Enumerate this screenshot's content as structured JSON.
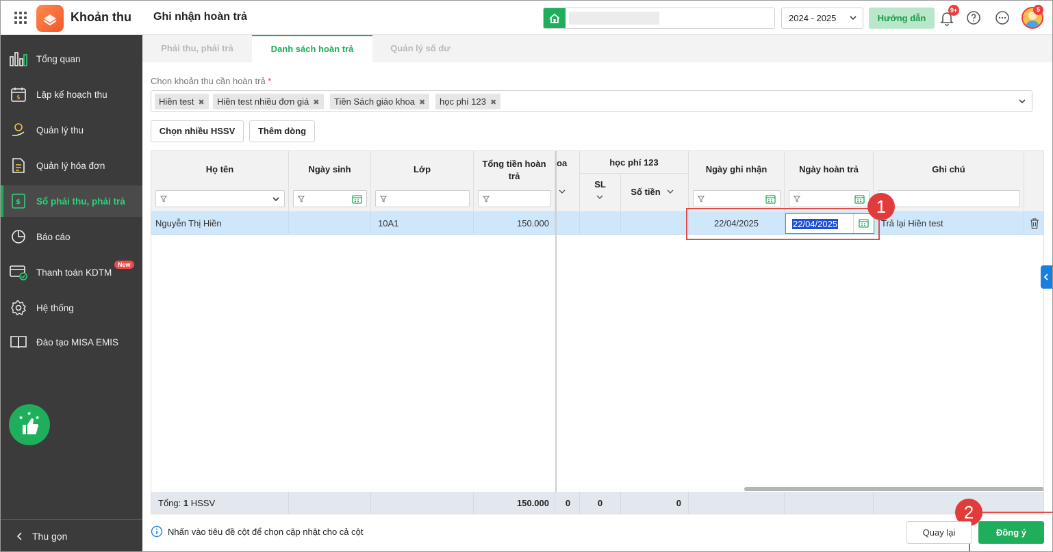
{
  "header": {
    "app_title": "Khoản thu",
    "page_title": "Ghi nhận hoàn trả",
    "school_year": "2024 - 2025",
    "guide_label": "Hướng dẫn",
    "notification_count": "9+",
    "avatar_badge": "5"
  },
  "sidebar": {
    "items": [
      {
        "label": "Tổng quan",
        "icon": "bar-chart-icon"
      },
      {
        "label": "Lập kế hoạch thu",
        "icon": "calendar-money-icon"
      },
      {
        "label": "Quản lý thu",
        "icon": "money-hand-icon"
      },
      {
        "label": "Quản lý hóa đơn",
        "icon": "invoice-icon"
      },
      {
        "label": "Sổ phải thu, phải trả",
        "icon": "ledger-icon",
        "active": true
      },
      {
        "label": "Báo cáo",
        "icon": "pie-chart-icon"
      },
      {
        "label": "Thanh toán KDTM",
        "icon": "card-payment-icon",
        "badge": "New"
      },
      {
        "label": "Hệ thống",
        "icon": "gear-icon"
      },
      {
        "label": "Đào tạo MISA EMIS",
        "icon": "book-icon"
      }
    ],
    "collapse_label": "Thu gọn"
  },
  "tabs": [
    {
      "label": "Phải thu, phải trả",
      "active": false
    },
    {
      "label": "Danh sách hoàn trả",
      "active": true
    },
    {
      "label": "Quản lý số dư",
      "active": false
    }
  ],
  "form": {
    "choose_label": "Chọn khoản thu cần hoàn trả",
    "required_mark": "*",
    "tags": [
      "Hiền test",
      "Hiền test nhiều đơn giá",
      "Tiền Sách giáo khoa",
      "học phí 123"
    ],
    "btn_choose_many": "Chọn nhiều HSSV",
    "btn_add_row": "Thêm dòng"
  },
  "grid": {
    "headers": {
      "name": "Họ tên",
      "dob": "Ngày sinh",
      "class": "Lớp",
      "total": "Tổng tiền hoàn trả",
      "partial": "oa",
      "group": "học phí 123",
      "qty": "SL",
      "amount": "Số tiền",
      "record_date": "Ngày ghi nhận",
      "refund_date": "Ngày hoàn trả",
      "note": "Ghi chú"
    },
    "rows": [
      {
        "name": "Nguyễn Thị Hiền",
        "dob": "",
        "class": "10A1",
        "total": "150.000",
        "record_date": "22/04/2025",
        "refund_date": "22/04/2025",
        "note": "Trả lại Hiền test"
      }
    ],
    "footer": {
      "total_label": "Tổng:",
      "count": "1",
      "count_unit": "HSSV",
      "total": "150.000",
      "partial": "0",
      "qty": "0",
      "amount": "0"
    }
  },
  "annotations": {
    "step1": "1",
    "step2": "2"
  },
  "bottom": {
    "note": "Nhấn vào tiêu đề cột để chọn cập nhật cho cả cột",
    "btn_back": "Quay lại",
    "btn_ok": "Đồng ý"
  },
  "colors": {
    "accent": "#1fae5b",
    "sidebar_bg": "#3b3b3b",
    "selected_row": "#cfe7fb",
    "annotation_red": "#e23b3b"
  }
}
